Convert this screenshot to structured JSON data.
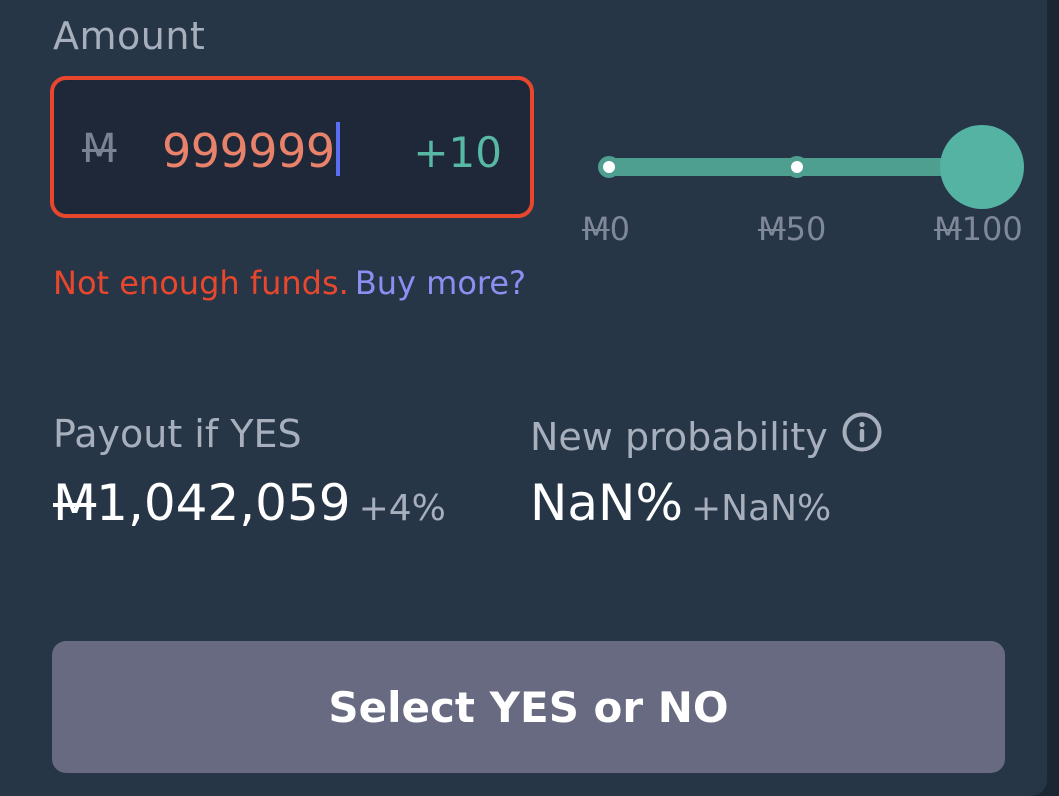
{
  "amount": {
    "label": "Amount",
    "currency_symbol": "M",
    "value": "999999",
    "increment_label": "+10"
  },
  "slider": {
    "level_percent": 100,
    "ticks": [
      {
        "currency": "M",
        "value": "0"
      },
      {
        "currency": "M",
        "value": "50"
      },
      {
        "currency": "M",
        "value": "100"
      }
    ]
  },
  "error": {
    "message": "Not enough funds.",
    "link": "Buy more?"
  },
  "payout": {
    "label": "Payout if YES",
    "currency": "M",
    "value": "1,042,059",
    "delta": "+4%"
  },
  "probability": {
    "label": "New probability",
    "value": "NaN%",
    "delta": "+NaN%",
    "icon": "info-icon"
  },
  "submit": {
    "label": "Select YES or NO"
  },
  "colors": {
    "error": "#e8472e",
    "accent": "#55b3a4",
    "link": "#8c8ff2",
    "input_text": "#e9826b"
  }
}
